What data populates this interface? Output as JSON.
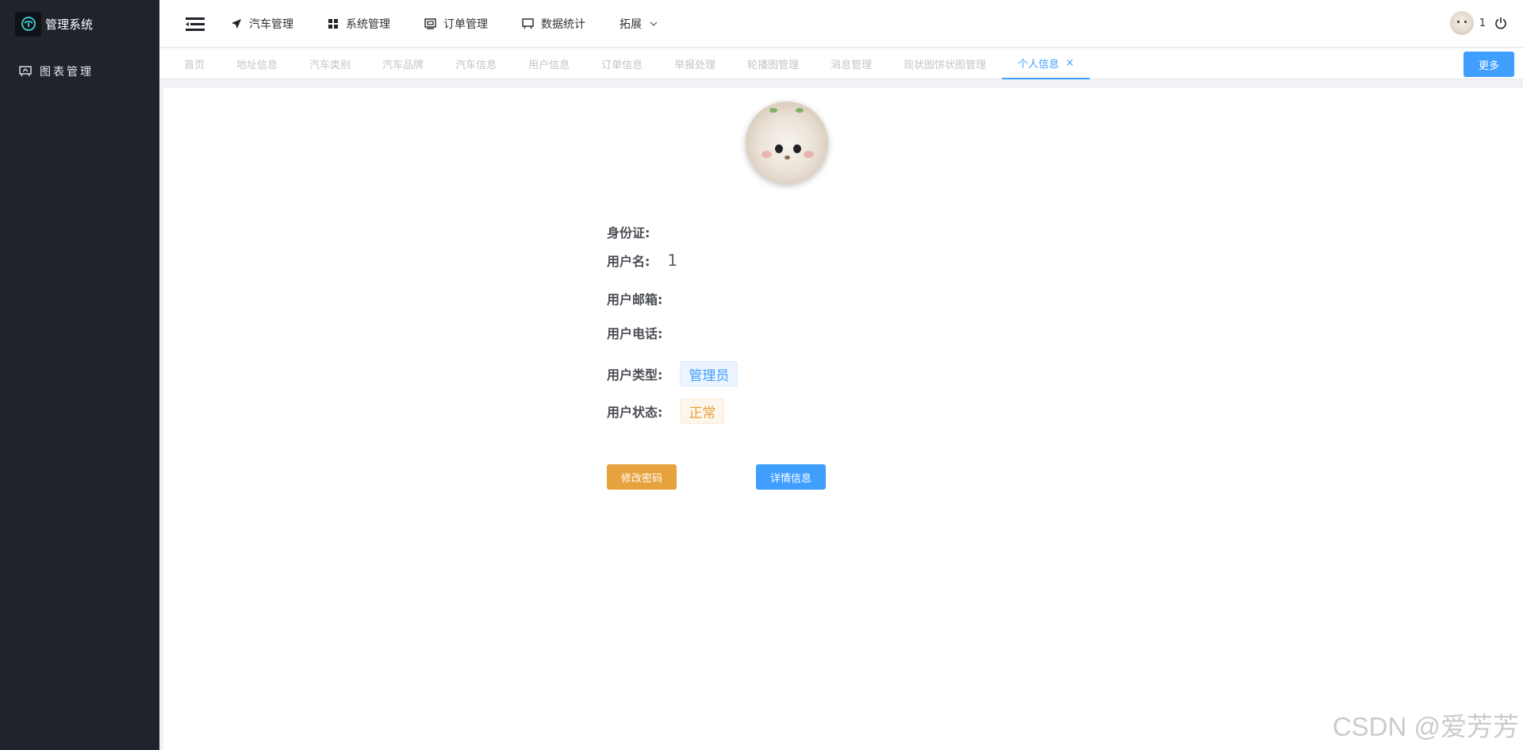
{
  "app": {
    "title": "管理系统"
  },
  "sidebar": {
    "items": [
      {
        "label": "图表管理",
        "icon": "chart-board-icon"
      }
    ]
  },
  "topnav": {
    "items": [
      {
        "label": "汽车管理",
        "icon": "send-icon"
      },
      {
        "label": "系统管理",
        "icon": "grid-icon"
      },
      {
        "label": "订单管理",
        "icon": "order-icon"
      },
      {
        "label": "数据统计",
        "icon": "board-icon"
      },
      {
        "label": "拓展",
        "icon": "chevron-down-icon"
      }
    ]
  },
  "header": {
    "username": "1"
  },
  "tags": {
    "items": [
      "首页",
      "地址信息",
      "汽车类别",
      "汽车品牌",
      "汽车信息",
      "用户信息",
      "订单信息",
      "举报处理",
      "轮播图管理",
      "消息管理",
      "现状图饼状图管理",
      "个人信息"
    ],
    "active_index": 11,
    "close_glyph": "×",
    "more_label": "更多"
  },
  "profile": {
    "id_card_label": "身份证:",
    "id_card_value": "",
    "username_label": "用户名:",
    "username_value": "1",
    "email_label": "用户邮箱:",
    "email_value": "",
    "phone_label": "用户电话:",
    "phone_value": "",
    "type_label": "用户类型:",
    "type_value": "管理员",
    "status_label": "用户状态:",
    "status_value": "正常"
  },
  "actions": {
    "change_password": "修改密码",
    "details": "详情信息"
  },
  "watermark": "CSDN @爱芳芳",
  "colors": {
    "primary": "#409eff",
    "warning": "#e6a23c",
    "sidebar_bg": "#1f232b"
  }
}
